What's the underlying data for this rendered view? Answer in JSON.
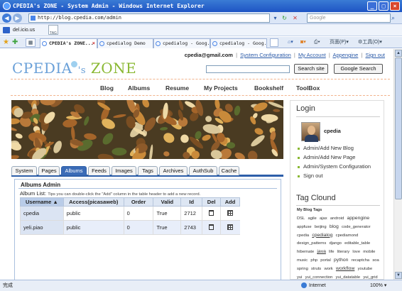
{
  "window": {
    "title": "CPEDIA's ZONE - System Admin - Windows Internet Explorer",
    "url": "http://blog.cpedia.com/admin",
    "search_placeholder": "Google"
  },
  "links_bar": {
    "delicious": "del.icio.us",
    "tag_label": "TAG"
  },
  "ie_tabs": [
    {
      "label": "CPEDIA's ZONE...",
      "active": true
    },
    {
      "label": "cpedialog Demo",
      "active": false
    },
    {
      "label": "cpedialog - Goog...",
      "active": false
    },
    {
      "label": "cpedialog - Goog...",
      "active": false
    }
  ],
  "command_bar": {
    "page_menu": "页面(P)",
    "tools_menu": "工具(O)"
  },
  "top_nav": {
    "email": "cpedia@gmail.com",
    "links": [
      "System Configuration",
      "My Account",
      "Appengine",
      "Sign out"
    ]
  },
  "logo": {
    "part1": "CPEDIA",
    "part2": "'s",
    "part3": "ZONE"
  },
  "search": {
    "site_button": "Search site",
    "google_button": "Google Search"
  },
  "main_nav": [
    "Blog",
    "Albums",
    "Resume",
    "My Projects",
    "Bookshelf",
    "ToolBox"
  ],
  "admin_tabs": [
    "System",
    "Pages",
    "Albums",
    "Feeds",
    "Images",
    "Tags",
    "Archives",
    "AuthSub",
    "Cache"
  ],
  "active_tab": "Albums",
  "panel": {
    "title": "Albums Admin",
    "list_label": "Album List:",
    "hint": "Tips you can double-click the \"Add\" column in the table header to add a new record."
  },
  "table": {
    "columns": [
      "Username",
      "Access(picasaweb)",
      "Order",
      "Valid",
      "Id",
      "Del",
      "Add"
    ],
    "sort_indicator": "▲",
    "rows": [
      {
        "username": "cpedia",
        "access": "public",
        "order": "0",
        "valid": "True",
        "id": "2712"
      },
      {
        "username": "yeli.piao",
        "access": "public",
        "order": "0",
        "valid": "True",
        "id": "2743"
      }
    ]
  },
  "sidebar": {
    "login_heading": "Login",
    "user": "cpedia",
    "links": [
      "Admin/Add New Blog",
      "Admin/Add New Page",
      "Admin/System Configuration",
      "Sign out"
    ],
    "tagcloud_heading": "Tag Clound",
    "tags_label": "My Blog Tags",
    "tags": [
      {
        "t": "DSL"
      },
      {
        "t": "agile"
      },
      {
        "t": "ajax"
      },
      {
        "t": "android"
      },
      {
        "t": "appengine",
        "s": "big"
      },
      {
        "t": "appfuse"
      },
      {
        "t": "beijing"
      },
      {
        "t": "blog",
        "s": "big"
      },
      {
        "t": "code_generator"
      },
      {
        "t": "cpedia"
      },
      {
        "t": "cpedialog",
        "s": "under"
      },
      {
        "t": "cpediamond"
      },
      {
        "t": "design_patterns"
      },
      {
        "t": "django"
      },
      {
        "t": "editable_table"
      },
      {
        "t": "hibernate"
      },
      {
        "t": "java",
        "s": "under"
      },
      {
        "t": "life"
      },
      {
        "t": "literary"
      },
      {
        "t": "love"
      },
      {
        "t": "mobile"
      },
      {
        "t": "music"
      },
      {
        "t": "php"
      },
      {
        "t": "portal"
      },
      {
        "t": "python",
        "s": "big"
      },
      {
        "t": "recaptcha"
      },
      {
        "t": "soa"
      },
      {
        "t": "spring"
      },
      {
        "t": "struts"
      },
      {
        "t": "work"
      },
      {
        "t": "workflow",
        "s": "under"
      },
      {
        "t": "youtube"
      },
      {
        "t": "yui"
      },
      {
        "t": "yui_connection"
      },
      {
        "t": "yui_datatable"
      },
      {
        "t": "yui_grid"
      }
    ]
  },
  "status_bar": {
    "status": "完成",
    "zone": "Internet",
    "zoom": "100%"
  },
  "colors": {
    "accent": "#2d5fa9",
    "tab_active": "#3b6cb7",
    "logo_blue": "#6aa0d8",
    "logo_green": "#8ab833",
    "nav_divider": "#f2b38c"
  }
}
